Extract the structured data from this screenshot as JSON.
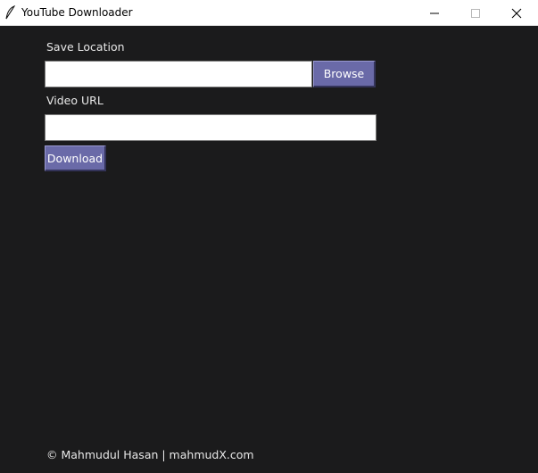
{
  "window": {
    "title": "YouTube Downloader",
    "app_icon": "feather-icon",
    "controls": {
      "minimize_icon": "minimize-icon",
      "maximize_icon": "maximize-icon",
      "close_icon": "close-icon"
    }
  },
  "form": {
    "save_location": {
      "label": "Save Location",
      "value": "",
      "browse_label": "Browse"
    },
    "video_url": {
      "label": "Video URL",
      "value": ""
    },
    "download_label": "Download"
  },
  "footer": {
    "text": "© Mahmudul Hasan | mahmudX.com"
  },
  "colors": {
    "background": "#1b1b1c",
    "button": "#6a6aa8",
    "text": "#e8e8e8"
  }
}
